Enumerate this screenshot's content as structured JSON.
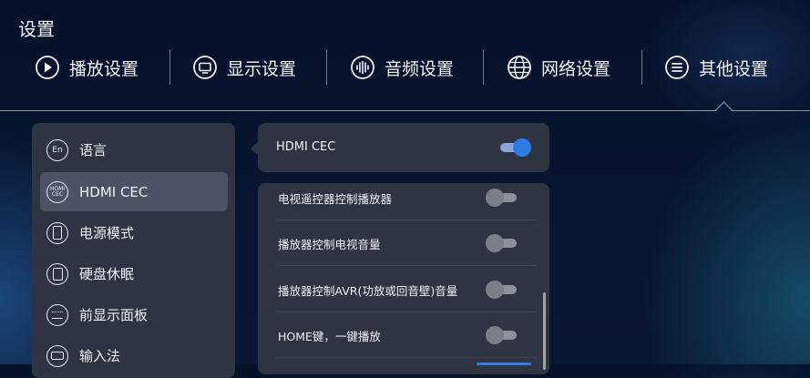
{
  "title": "设置",
  "tabs": [
    {
      "label": "播放设置",
      "icon": "play-circle-icon"
    },
    {
      "label": "显示设置",
      "icon": "display-icon"
    },
    {
      "label": "音频设置",
      "icon": "audio-wave-icon"
    },
    {
      "label": "网络设置",
      "icon": "globe-icon"
    },
    {
      "label": "其他设置",
      "icon": "menu-circle-icon"
    }
  ],
  "active_tab": "其他设置",
  "sidebar": {
    "items": [
      {
        "label": "语言",
        "icon": "language-icon",
        "icon_text": "En"
      },
      {
        "label": "HDMI CEC",
        "icon": "hdmi-cec-icon",
        "icon_text": "HDMI CEC"
      },
      {
        "label": "电源模式",
        "icon": "power-mode-icon"
      },
      {
        "label": "硬盘休眠",
        "icon": "disk-sleep-icon"
      },
      {
        "label": "前显示面板",
        "icon": "front-panel-icon"
      },
      {
        "label": "输入法",
        "icon": "keyboard-icon"
      }
    ],
    "active_item": "HDMI CEC"
  },
  "hdmi_cec": {
    "label": "HDMI CEC",
    "enabled": true
  },
  "options": [
    {
      "label": "电视遥控器控制播放器",
      "enabled": false
    },
    {
      "label": "播放器控制电视音量",
      "enabled": false
    },
    {
      "label": "播放器控制AVR(功放或回音壁)音量",
      "enabled": false
    },
    {
      "label": "HOME键，一键播放",
      "enabled": false
    }
  ],
  "colors": {
    "accent": "#2f7be6",
    "panel": "#2e3442",
    "panel_active": "#4c5363",
    "background": "#06112a"
  }
}
